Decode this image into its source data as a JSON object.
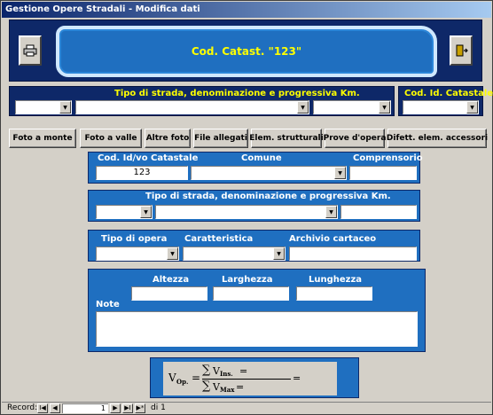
{
  "window": {
    "title": "Gestione Opere Stradali - Modifica dati"
  },
  "header": {
    "banner_text": "Cod. Catast. \"123\"",
    "print_icon": "printer-icon",
    "exit_icon": "exit-door-icon"
  },
  "filter_bar": {
    "road_label": "Tipo di strada, denominazione e progressiva Km.",
    "catasto_label": "Cod. Id. Catastale"
  },
  "buttons": [
    "Foto a monte",
    "Foto a valle",
    "Altre foto",
    "File allegati",
    "Elem. strutturali",
    "Prove d'opera",
    "Difett. elem. accessori"
  ],
  "panel1": {
    "cod_label": "Cod. Id/vo Catastale",
    "cod_value": "123",
    "comune_label": "Comune",
    "comprensorio_label": "Comprensorio"
  },
  "panel2": {
    "road_label": "Tipo di strada, denominazione e progressiva Km."
  },
  "panel3": {
    "tipo_label": "Tipo di opera",
    "caratteristica_label": "Caratteristica",
    "archivio_label": "Archivio cartaceo"
  },
  "panel4": {
    "altezza_label": "Altezza",
    "larghezza_label": "Larghezza",
    "lunghezza_label": "Lunghezza",
    "note_label": "Note"
  },
  "formula": {
    "vop": "V",
    "vop_sub": "Op.",
    "eq": "=",
    "sum": "∑",
    "num_v": "V",
    "num_sub": "Ins.",
    "den_v": "V",
    "den_sub": "Max",
    "eq2": "="
  },
  "status": {
    "record_label": "Record:",
    "first": "I◀",
    "prev": "◀",
    "current": "1",
    "next": "▶",
    "last": "▶I",
    "new": "▶*",
    "total": "di 1"
  },
  "colors": {
    "navy": "#0e2868",
    "blue": "#1f6fc0",
    "yellow": "#ffff00"
  }
}
